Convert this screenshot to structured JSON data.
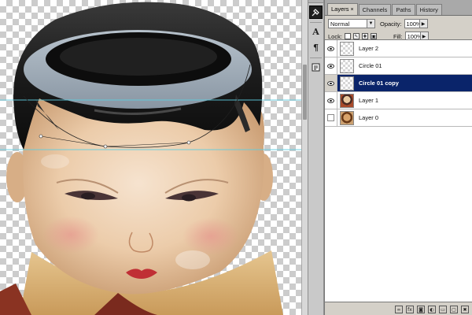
{
  "panel": {
    "tabs": [
      {
        "label": "Layers",
        "close": "×"
      },
      {
        "label": "Channels"
      },
      {
        "label": "Paths"
      },
      {
        "label": "History"
      }
    ],
    "blend_mode": "Normal",
    "opacity_label": "Opacity:",
    "opacity_value": "100%",
    "lock_label": "Lock:",
    "fill_label": "Fill:",
    "fill_value": "100%"
  },
  "layers": [
    {
      "name": "Layer 2",
      "visible": true,
      "selected": false,
      "thumb": "transparent"
    },
    {
      "name": "Circle 01",
      "visible": true,
      "selected": false,
      "thumb": "transparent"
    },
    {
      "name": "Circle 01 copy",
      "visible": true,
      "selected": true,
      "thumb": "transparent"
    },
    {
      "name": "Layer 1",
      "visible": true,
      "selected": false,
      "thumb": "doll"
    },
    {
      "name": "Layer 0",
      "visible": false,
      "selected": false,
      "thumb": "face"
    }
  ],
  "toolstrip": {
    "tools": [
      "tool-preset-icon",
      "character-icon",
      "paragraph-icon",
      "info-icon"
    ]
  },
  "colors": {
    "selection": "#0a246a",
    "guide": "#5ecde0",
    "ring": "#9aa7b4",
    "hair": "#1a1a1a"
  }
}
